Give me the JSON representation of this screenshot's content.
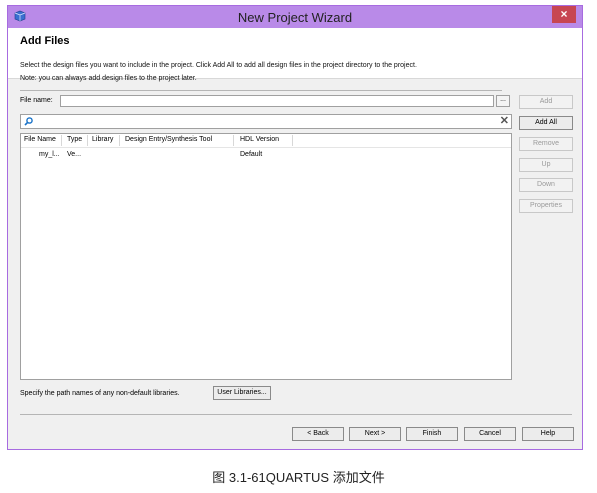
{
  "window": {
    "title": "New Project Wizard",
    "close": "×"
  },
  "header": {
    "title": "Add Files",
    "description": "Select the design files you want to include in the project. Click Add All to add all design files in the project directory to the project.",
    "note": "Note: you can always add design files to the project later."
  },
  "file_name": {
    "label": "File name:",
    "value": "",
    "browse_label": "..."
  },
  "table": {
    "columns": [
      "File Name",
      "Type",
      "Library",
      "Design Entry/Synthesis Tool",
      "HDL Version"
    ],
    "rows": [
      {
        "file": "my_l...",
        "type": "Ve...",
        "library": "",
        "tool": "",
        "hdl": "Default"
      }
    ]
  },
  "side_buttons": {
    "add": "Add",
    "add_all": "Add All",
    "remove": "Remove",
    "up": "Up",
    "down": "Down",
    "properties": "Properties"
  },
  "libraries": {
    "label": "Specify the path names of any non-default libraries.",
    "button": "User Libraries..."
  },
  "footer": {
    "back": "< Back",
    "next": "Next >",
    "finish": "Finish",
    "cancel": "Cancel",
    "help": "Help"
  },
  "caption": "图 3.1-61QUARTUS 添加文件"
}
